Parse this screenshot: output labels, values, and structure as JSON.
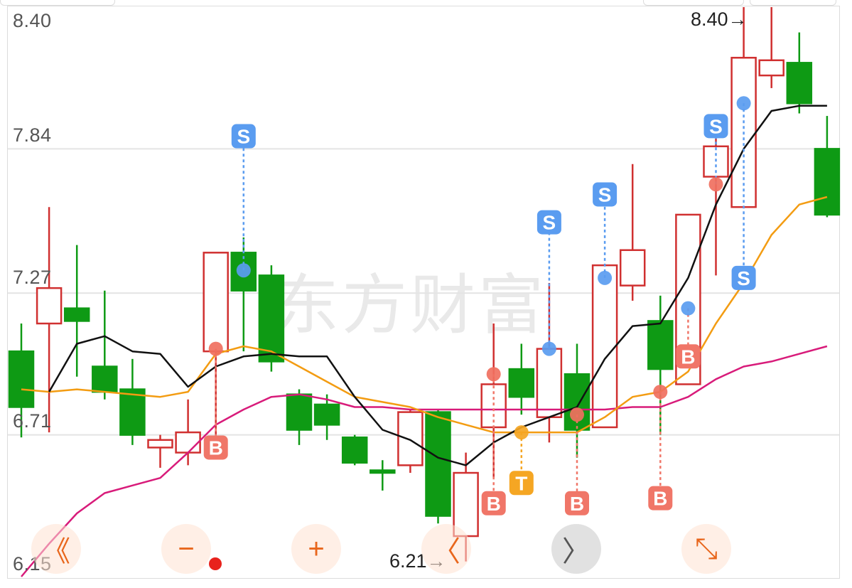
{
  "watermark": "东方财富",
  "y_labels": [
    "8.40",
    "7.84",
    "7.27",
    "6.71",
    "6.15"
  ],
  "high_marker": "8.40→",
  "low_marker": "6.21→",
  "controls": {
    "rewind": "《",
    "zoom_out": "−",
    "zoom_in": "+",
    "prev": "〈",
    "next": "〉",
    "expand": "⤡"
  },
  "colors": {
    "up": "#d03030",
    "down": "#0e9a14",
    "ma_fast": "#111111",
    "ma_mid": "#f39c12",
    "ma_slow": "#d81b7a",
    "sell": "#5a9cf0",
    "buy": "#f07668",
    "t_signal": "#f5a623"
  },
  "chart_data": {
    "type": "candlestick",
    "ylim": [
      6.15,
      8.4
    ],
    "yticks": [
      8.4,
      7.84,
      7.27,
      6.71,
      6.15
    ],
    "candles": [
      {
        "o": 7.04,
        "c": 6.82,
        "h": 7.15,
        "l": 6.7
      },
      {
        "o": 7.15,
        "c": 7.29,
        "h": 7.61,
        "l": 6.72
      },
      {
        "o": 7.21,
        "c": 7.16,
        "h": 7.46,
        "l": 6.94
      },
      {
        "o": 6.98,
        "c": 6.88,
        "h": 7.28,
        "l": 6.85
      },
      {
        "o": 6.89,
        "c": 6.71,
        "h": 7.01,
        "l": 6.67
      },
      {
        "o": 6.66,
        "c": 6.69,
        "h": 6.71,
        "l": 6.58
      },
      {
        "o": 6.64,
        "c": 6.72,
        "h": 6.85,
        "l": 6.59
      },
      {
        "o": 7.04,
        "c": 7.43,
        "h": 7.43,
        "l": 6.66
      },
      {
        "o": 7.43,
        "c": 7.28,
        "h": 7.49,
        "l": 7.04
      },
      {
        "o": 7.34,
        "c": 7.0,
        "h": 7.38,
        "l": 6.96
      },
      {
        "o": 6.87,
        "c": 6.73,
        "h": 6.89,
        "l": 6.67
      },
      {
        "o": 6.83,
        "c": 6.75,
        "h": 6.87,
        "l": 6.69
      },
      {
        "o": 6.7,
        "c": 6.6,
        "h": 6.71,
        "l": 6.59
      },
      {
        "o": 6.57,
        "c": 6.56,
        "h": 6.61,
        "l": 6.49
      },
      {
        "o": 6.59,
        "c": 6.8,
        "h": 6.81,
        "l": 6.56
      },
      {
        "o": 6.8,
        "c": 6.39,
        "h": 6.81,
        "l": 6.36
      },
      {
        "o": 6.31,
        "c": 6.56,
        "h": 6.64,
        "l": 6.21
      },
      {
        "o": 6.74,
        "c": 6.91,
        "h": 7.15,
        "l": 6.54
      },
      {
        "o": 6.97,
        "c": 6.86,
        "h": 7.07,
        "l": 6.79
      },
      {
        "o": 6.78,
        "c": 7.05,
        "h": 7.31,
        "l": 6.68
      },
      {
        "o": 6.95,
        "c": 6.73,
        "h": 7.07,
        "l": 6.62
      },
      {
        "o": 6.74,
        "c": 7.38,
        "h": 7.38,
        "l": 6.74
      },
      {
        "o": 7.3,
        "c": 7.44,
        "h": 7.78,
        "l": 7.24
      },
      {
        "o": 7.16,
        "c": 6.97,
        "h": 7.26,
        "l": 6.71
      },
      {
        "o": 6.91,
        "c": 7.58,
        "h": 7.58,
        "l": 6.91
      },
      {
        "o": 7.73,
        "c": 7.85,
        "h": 7.93,
        "l": 7.34
      },
      {
        "o": 7.61,
        "c": 8.2,
        "h": 8.4,
        "l": 7.61
      },
      {
        "o": 8.13,
        "c": 8.19,
        "h": 8.4,
        "l": 8.08
      },
      {
        "o": 8.18,
        "c": 8.02,
        "h": 8.3,
        "l": 7.98
      },
      {
        "o": 7.84,
        "c": 7.58,
        "h": 7.97,
        "l": 7.57
      }
    ],
    "ma_fast": [
      null,
      6.88,
      7.07,
      7.1,
      7.04,
      7.03,
      6.9,
      6.98,
      7.02,
      7.03,
      7.02,
      7.02,
      6.86,
      6.73,
      6.69,
      6.62,
      6.59,
      6.68,
      6.74,
      6.78,
      6.82,
      7.01,
      7.14,
      7.15,
      7.33,
      7.62,
      7.84,
      7.99,
      8.01,
      8.01
    ],
    "ma_mid": [
      6.89,
      6.88,
      6.89,
      6.88,
      6.87,
      6.86,
      6.88,
      7.03,
      7.06,
      7.04,
      6.98,
      6.92,
      6.86,
      6.84,
      6.82,
      6.78,
      6.75,
      6.72,
      6.72,
      6.72,
      6.72,
      6.78,
      6.86,
      6.88,
      6.96,
      7.15,
      7.31,
      7.5,
      7.62,
      7.65
    ],
    "ma_slow": [
      6.15,
      6.28,
      6.4,
      6.48,
      6.51,
      6.54,
      6.64,
      6.75,
      6.81,
      6.86,
      6.87,
      6.85,
      6.82,
      6.82,
      6.81,
      6.81,
      6.81,
      6.81,
      6.81,
      6.81,
      6.81,
      6.81,
      6.82,
      6.82,
      6.86,
      6.93,
      6.98,
      7.0,
      7.03,
      7.06
    ],
    "signals": [
      {
        "i": 7,
        "label": "B",
        "y": 6.66
      },
      {
        "i": 8,
        "label": "S",
        "y": 7.89
      },
      {
        "i": 17,
        "label": "B",
        "y": 6.44
      },
      {
        "i": 18,
        "label": "T",
        "y": 6.52
      },
      {
        "i": 19,
        "label": "S",
        "y": 7.55
      },
      {
        "i": 20,
        "label": "B",
        "y": 6.44
      },
      {
        "i": 21,
        "label": "S",
        "y": 7.66
      },
      {
        "i": 23,
        "label": "B",
        "y": 6.46
      },
      {
        "i": 24,
        "label": "B",
        "y": 7.02
      },
      {
        "i": 25,
        "label": "S",
        "y": 7.93
      },
      {
        "i": 26,
        "label": "S",
        "y": 7.33
      }
    ],
    "points": [
      {
        "i": 7,
        "kind": "buy",
        "y": 7.05
      },
      {
        "i": 8,
        "kind": "sell",
        "y": 7.36
      },
      {
        "i": 17,
        "kind": "buy",
        "y": 6.95
      },
      {
        "i": 18,
        "kind": "t",
        "y": 6.72
      },
      {
        "i": 19,
        "kind": "sell",
        "y": 7.05
      },
      {
        "i": 20,
        "kind": "buy",
        "y": 6.79
      },
      {
        "i": 21,
        "kind": "sell",
        "y": 7.33
      },
      {
        "i": 23,
        "kind": "buy",
        "y": 6.88
      },
      {
        "i": 24,
        "kind": "sell",
        "y": 7.21
      },
      {
        "i": 25,
        "kind": "buy",
        "y": 7.7
      },
      {
        "i": 26,
        "kind": "sell",
        "y": 8.02
      }
    ]
  }
}
